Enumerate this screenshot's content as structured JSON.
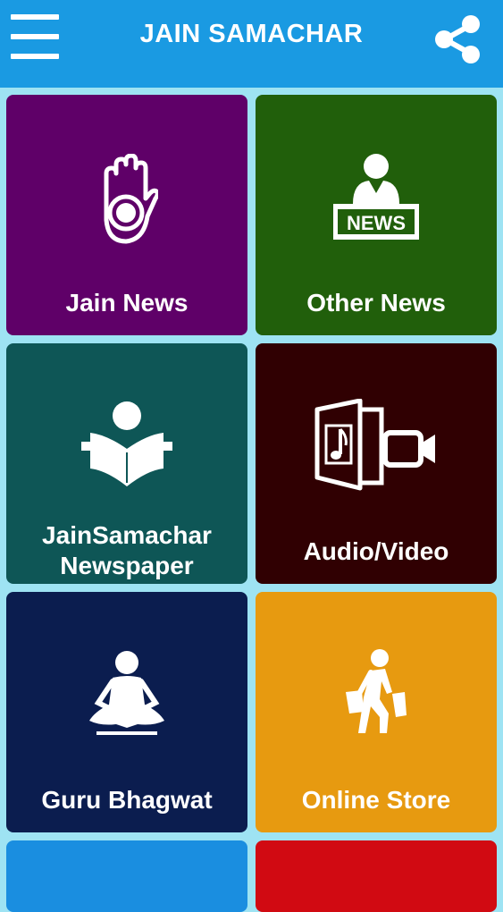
{
  "header": {
    "title": "JAIN SAMACHAR",
    "menu_icon": "hamburger-menu-icon",
    "share_icon": "share-icon",
    "color": "#1a9ae2"
  },
  "tiles": [
    {
      "label": "Jain News",
      "icon": "ahimsa-hand-icon",
      "color": "#5f0068"
    },
    {
      "label": "Other News",
      "icon": "news-anchor-icon",
      "color": "#215f0b"
    },
    {
      "label_line1": "JainSamachar",
      "label_line2": "Newspaper",
      "icon": "reading-newspaper-icon",
      "color": "#0e5656"
    },
    {
      "label": "Audio/Video",
      "icon": "audio-video-icon",
      "color": "#300002"
    },
    {
      "label": "Guru Bhagwat",
      "icon": "meditation-guru-icon",
      "color": "#0b1d4f"
    },
    {
      "label": "Online Store",
      "icon": "shopping-person-icon",
      "color": "#e79a10"
    },
    {
      "color": "#1a8ee0"
    },
    {
      "color": "#d10a12"
    }
  ]
}
